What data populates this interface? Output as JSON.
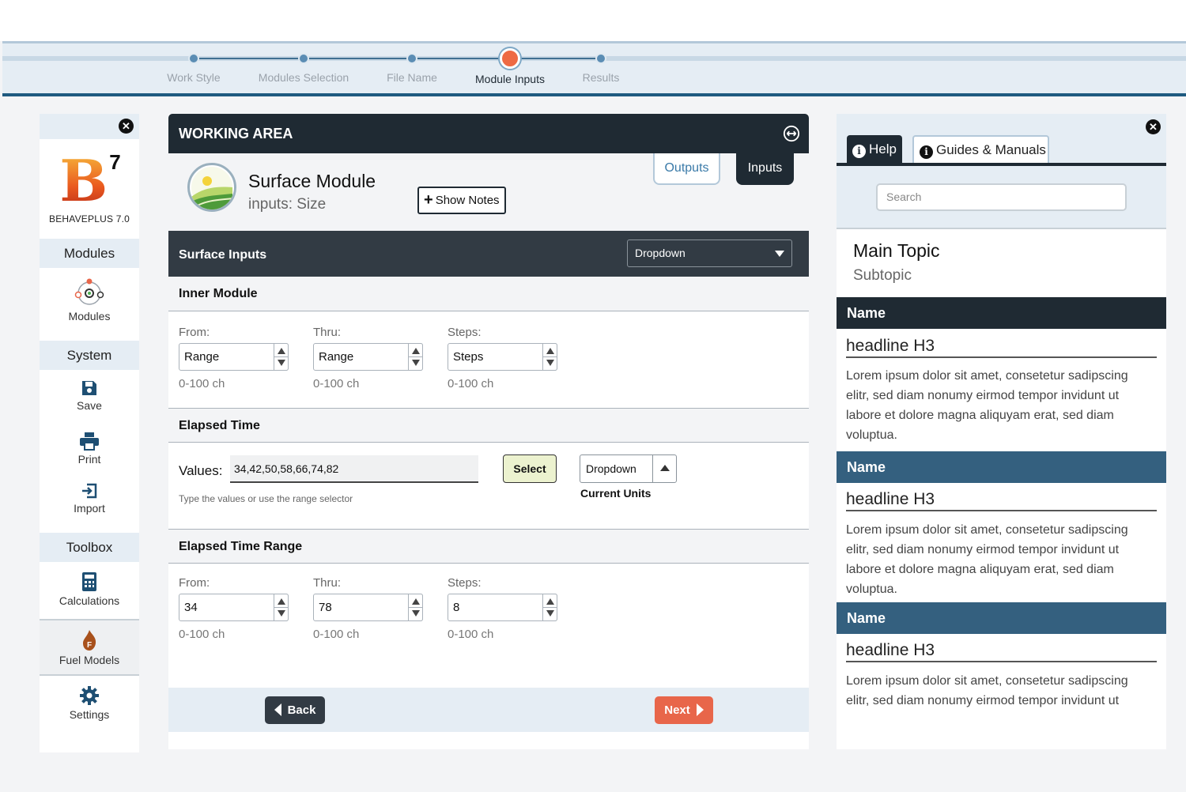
{
  "stepper": {
    "steps": [
      {
        "label": "Work Style",
        "active": false
      },
      {
        "label": "Modules Selection",
        "active": false
      },
      {
        "label": "File Name",
        "active": false
      },
      {
        "label": "Module Inputs",
        "active": true
      },
      {
        "label": "Results",
        "active": false
      }
    ],
    "accent_color": "#ee6a44"
  },
  "sidebar": {
    "close_icon": "close-icon",
    "logo": {
      "letter": "B",
      "version_mark": "7",
      "name": "BEHAVEPLUS 7.0"
    },
    "modules_header": "Modules",
    "modules_item": "Modules",
    "system_header": "System",
    "save": "Save",
    "print": "Print",
    "import": "Import",
    "toolbox_header": "Toolbox",
    "calculations": "Calculations",
    "fuel_models": "Fuel Models",
    "settings": "Settings"
  },
  "work": {
    "title": "WORKING AREA",
    "module_title": "Surface Module",
    "module_subtitle": "inputs: Size",
    "show_notes": "Show Notes",
    "outputs_tab": "Outputs",
    "inputs_tab": "Inputs",
    "surface_inputs": "Surface Inputs",
    "dropdown_value": "Dropdown",
    "inner_module": {
      "title": "Inner Module",
      "fields": [
        {
          "label": "From:",
          "value": "Range",
          "hint": "0-100 ch"
        },
        {
          "label": "Thru:",
          "value": "Range",
          "hint": "0-100 ch"
        },
        {
          "label": "Steps:",
          "value": "Steps",
          "hint": "0-100 ch"
        }
      ]
    },
    "elapsed_time": {
      "title": "Elapsed Time",
      "values_label": "Values:",
      "values": "34,42,50,58,66,74,82",
      "hint": "Type the values or use the range selector",
      "select_button": "Select",
      "units_dropdown": "Dropdown",
      "units_label": "Current Units"
    },
    "elapsed_range": {
      "title": "Elapsed Time Range",
      "fields": [
        {
          "label": "From:",
          "value": "34",
          "hint": "0-100 ch"
        },
        {
          "label": "Thru:",
          "value": "78",
          "hint": "0-100 ch"
        },
        {
          "label": "Steps:",
          "value": "8",
          "hint": "0-100 ch"
        }
      ]
    },
    "back": "Back",
    "next": "Next"
  },
  "help": {
    "tab_help": "Help",
    "tab_guides": "Guides & Manuals",
    "search_placeholder": "Search",
    "main_topic": "Main Topic",
    "subtopic": "Subtopic",
    "sections": [
      {
        "name": "Name",
        "headline": "headline H3",
        "text": "Lorem ipsum dolor sit amet, consetetur sadipscing elitr, sed diam nonumy eirmod tempor invidunt ut labore et dolore magna aliquyam erat, sed diam voluptua.",
        "color": "#1f2a33"
      },
      {
        "name": "Name",
        "headline": "headline H3",
        "text": "Lorem ipsum dolor sit amet, consetetur sadipscing elitr, sed diam nonumy eirmod tempor invidunt ut labore et dolore magna aliquyam erat, sed diam voluptua.",
        "color": "#34607f"
      },
      {
        "name": "Name",
        "headline": "headline H3",
        "text": "Lorem ipsum dolor sit amet, consetetur sadipscing elitr, sed diam nonumy eirmod tempor invidunt ut",
        "color": "#34607f"
      }
    ]
  }
}
